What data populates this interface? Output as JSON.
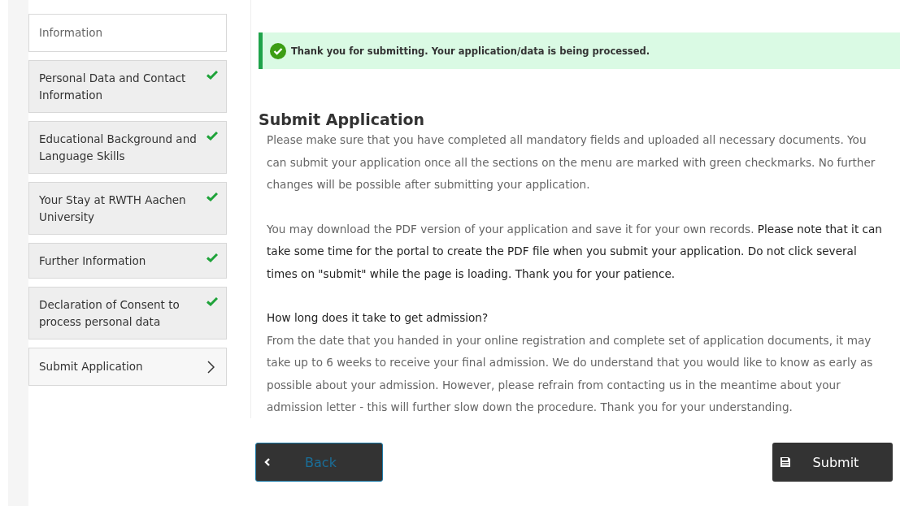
{
  "sidebar": {
    "items": [
      {
        "label": "Information",
        "kind": "info",
        "completed": false,
        "selected": false
      },
      {
        "label": "Personal Data and Contact Information",
        "kind": "step",
        "completed": true,
        "selected": false
      },
      {
        "label": "Educational Background and Language Skills",
        "kind": "step",
        "completed": true,
        "selected": false
      },
      {
        "label": "Your Stay at RWTH Aachen University",
        "kind": "step",
        "completed": true,
        "selected": false
      },
      {
        "label": "Further Information",
        "kind": "step",
        "completed": true,
        "selected": false
      },
      {
        "label": "Declaration of Consent to process personal data",
        "kind": "step",
        "completed": true,
        "selected": false
      },
      {
        "label": "Submit Application",
        "kind": "step",
        "completed": false,
        "selected": true
      }
    ]
  },
  "alert": {
    "kind": "success",
    "text": "Thank you for submitting. Your application/data is being processed."
  },
  "heading": "Submit Application",
  "paragraphs": [
    {
      "kind": "text",
      "text": "Please make sure that you have completed all mandatory fields and uploaded all necessary documents. You can submit your application once all the sections on the menu are marked with green checkmarks. No further changes will be possible after submitting your application."
    },
    {
      "kind": "text",
      "text": "You may download the PDF version of your application and save it for your own records. **Please note that it can take some time for the portal to create the PDF file when you submit your application. Do not click several times on \"submit\" while the page is loading. Thank you for your patience.**"
    },
    {
      "kind": "subheading",
      "text": "How long does it take to get admission?"
    },
    {
      "kind": "text",
      "text": "From the date that you handed in your online registration and complete set of application documents, it may take up to 6 weeks to receive your final admission. We do understand that you would like to know as early as possible about your admission. However, please refrain from contacting us in the meantime about your admission letter - this will further slow down the procedure. Thank you for your understanding."
    }
  ],
  "buttons": [
    {
      "kind": "back",
      "label": "Back"
    },
    {
      "kind": "submit",
      "label": "Submit"
    }
  ]
}
